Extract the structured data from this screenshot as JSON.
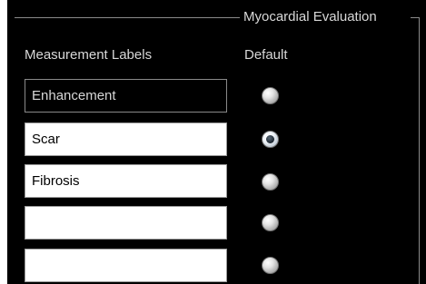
{
  "group": {
    "title": "Myocardial Evaluation"
  },
  "columns": {
    "labels_header": "Measurement Labels",
    "default_header": "Default"
  },
  "rows": [
    {
      "label": "Enhancement",
      "editable": false,
      "default_selected": false
    },
    {
      "label": "Scar",
      "editable": true,
      "default_selected": true
    },
    {
      "label": "Fibrosis",
      "editable": true,
      "default_selected": false
    },
    {
      "label": "",
      "editable": true,
      "default_selected": false
    },
    {
      "label": "",
      "editable": true,
      "default_selected": false
    }
  ],
  "colors": {
    "panel_background": "#000000",
    "text": "#d8d8d8",
    "field_background": "#ffffff",
    "group_border": "#8a8a8a"
  }
}
